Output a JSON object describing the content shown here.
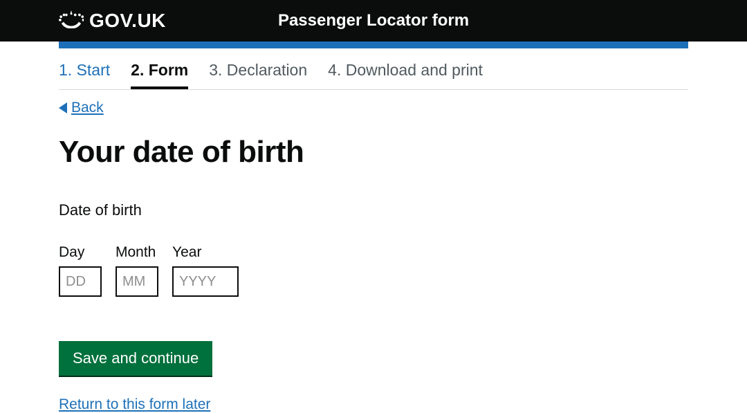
{
  "header": {
    "logo_text": "GOV.UK",
    "title": "Passenger Locator form"
  },
  "steps": [
    {
      "label": "1. Start",
      "state": "completed"
    },
    {
      "label": "2. Form",
      "state": "current"
    },
    {
      "label": "3. Declaration",
      "state": "upcoming"
    },
    {
      "label": "4. Download and print",
      "state": "upcoming"
    }
  ],
  "back_link": "Back",
  "page_heading": "Your date of birth",
  "fieldset": {
    "legend": "Date of birth",
    "day": {
      "label": "Day",
      "placeholder": "DD",
      "value": ""
    },
    "month": {
      "label": "Month",
      "placeholder": "MM",
      "value": ""
    },
    "year": {
      "label": "Year",
      "placeholder": "YYYY",
      "value": ""
    }
  },
  "buttons": {
    "save": "Save and continue",
    "return_later": "Return to this form later"
  }
}
